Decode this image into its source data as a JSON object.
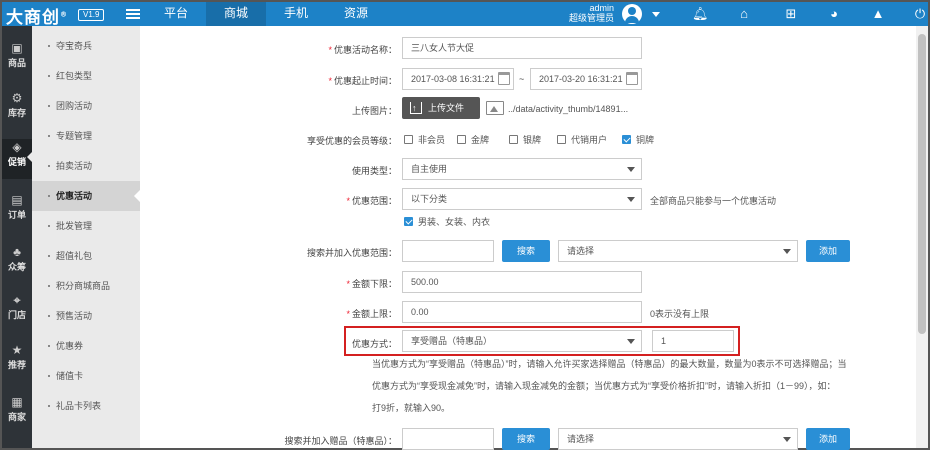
{
  "header": {
    "logo": "大商创",
    "version": "V1.9",
    "nav": [
      "平台",
      "商城",
      "手机",
      "资源"
    ],
    "active_nav": "商城",
    "username": "admin",
    "role": "超级管理员"
  },
  "rail": [
    {
      "label": "商品",
      "icon": "goods-icon"
    },
    {
      "label": "库存",
      "icon": "stock-icon"
    },
    {
      "label": "促销",
      "icon": "promotion-icon"
    },
    {
      "label": "订单",
      "icon": "order-icon"
    },
    {
      "label": "众筹",
      "icon": "crowdfunding-icon"
    },
    {
      "label": "门店",
      "icon": "store-icon"
    },
    {
      "label": "推荐",
      "icon": "star-icon"
    },
    {
      "label": "商家",
      "icon": "merchant-icon"
    }
  ],
  "submenu": [
    "夺宝奇兵",
    "红包类型",
    "团购活动",
    "专题管理",
    "拍卖活动",
    "优惠活动",
    "批发管理",
    "超值礼包",
    "积分商城商品",
    "预售活动",
    "优惠券",
    "储值卡",
    "礼品卡列表"
  ],
  "submenu_active": "优惠活动",
  "form": {
    "name_label": "优惠活动名称：",
    "name_value": "三八女人节大促",
    "time_label": "优惠起止时间：",
    "start_time": "2017-03-08 16:31:21",
    "end_time": "2017-03-20 16:31:21",
    "tilde": "~",
    "image_label": "上传图片：",
    "upload_btn": "上传文件",
    "image_path": "../data/activity_thumb/14891...",
    "member_label": "享受优惠的会员等级：",
    "member_levels": [
      {
        "label": "非会员",
        "checked": false
      },
      {
        "label": "金牌",
        "checked": false
      },
      {
        "label": "银牌",
        "checked": false
      },
      {
        "label": "代销用户",
        "checked": false
      },
      {
        "label": "铜牌",
        "checked": true
      }
    ],
    "use_type_label": "使用类型：",
    "use_type_value": "自主使用",
    "range_label": "优惠范围：",
    "range_value": "以下分类",
    "range_hint": "全部商品只能参与一个优惠活动",
    "range_category": "男装、女装、内衣",
    "search_range_label": "搜索并加入优惠范围：",
    "search_btn": "搜索",
    "select_placeholder": "请选择",
    "add_btn": "添加",
    "min_amount_label": "金额下限：",
    "min_amount": "500.00",
    "max_amount_label": "金额上限：",
    "max_amount": "0.00",
    "max_amount_hint": "0表示没有上限",
    "discount_label": "优惠方式：",
    "discount_value": "享受赠品（特惠品）",
    "discount_qty": "1",
    "help_line1": "当优惠方式为“享受赠品（特惠品）”时，请输入允许买家选择赠品（特惠品）的最大数量，数量为0表示不可选择赠品；当",
    "help_line2": "优惠方式为“享受现金减免”时，请输入现金减免的金额；当优惠方式为“享受价格折扣”时，请输入折扣（1－99），如：",
    "help_line3": "打9折，就输入90。",
    "search_gift_label": "搜索并加入赠品（特惠品）："
  },
  "colors": {
    "accent": "#1d82c7",
    "highlight": "#d42020"
  }
}
